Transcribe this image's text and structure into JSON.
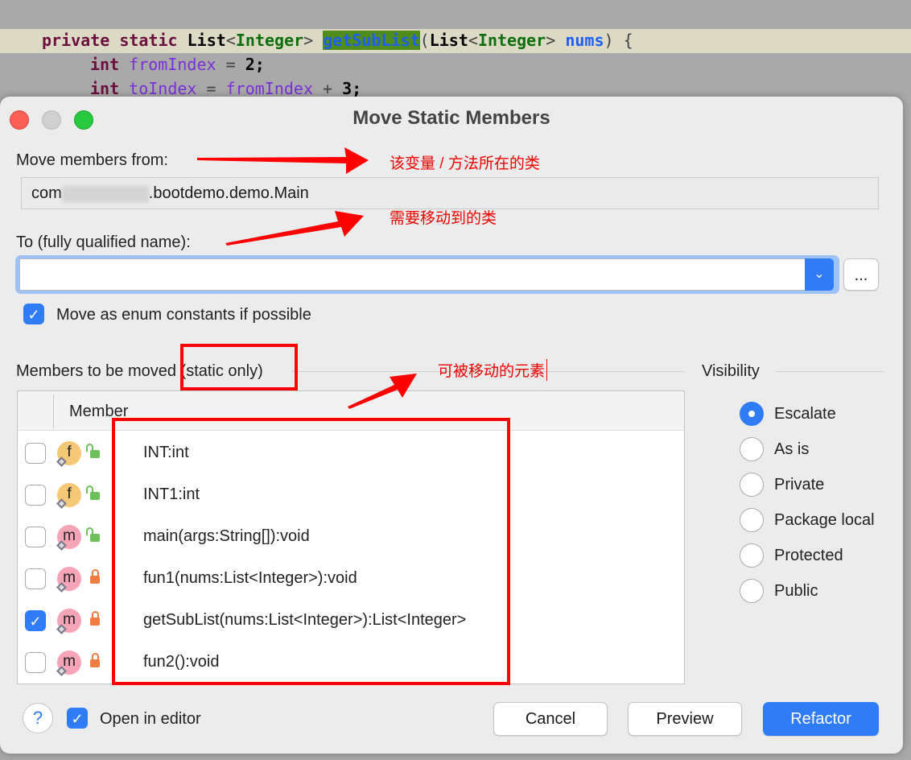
{
  "editor": {
    "line1": {
      "kw1": "private",
      "kw2": "static",
      "type": "List",
      "lt": "<",
      "gen": "Integer",
      "gt": ">",
      "name": "getSubList",
      "open": "(",
      "ptype": "List",
      "pgen": "Integer",
      "param": "nums",
      "close": ") {"
    },
    "line2": {
      "kw": "int",
      "var": "fromIndex",
      "op": "=",
      "val": "2;"
    },
    "line3": {
      "kw": "int",
      "var": "toIndex",
      "op": "=",
      "var2": "fromIndex",
      "plus": "+",
      "val": "3;"
    }
  },
  "dialog": {
    "title": "Move Static Members",
    "from_label": "Move members from:",
    "from_prefix": "com",
    "from_suffix": ".bootdemo.demo.Main",
    "to_label": "To (fully qualified name):",
    "to_value": "",
    "browse_label": "...",
    "enum_label": "Move as enum constants if possible",
    "enum_checked": true,
    "members_label": "Members to be moved (static only)",
    "member_header": "Member",
    "members": [
      {
        "name": "INT:int",
        "kind": "f",
        "access": "public",
        "checked": false
      },
      {
        "name": "INT1:int",
        "kind": "f",
        "access": "public",
        "checked": false
      },
      {
        "name": "main(args:String[]):void",
        "kind": "m",
        "access": "public",
        "checked": false
      },
      {
        "name": "fun1(nums:List<Integer>):void",
        "kind": "m",
        "access": "private",
        "checked": false
      },
      {
        "name": "getSubList(nums:List<Integer>):List<Integer>",
        "kind": "m",
        "access": "private",
        "checked": true
      },
      {
        "name": "fun2():void",
        "kind": "m",
        "access": "private",
        "checked": false
      }
    ],
    "visibility_label": "Visibility",
    "visibility": [
      {
        "label": "Escalate",
        "selected": true
      },
      {
        "label": "As is"
      },
      {
        "label": "Private"
      },
      {
        "label": "Package local"
      },
      {
        "label": "Protected"
      },
      {
        "label": "Public"
      }
    ],
    "help": "?",
    "open_editor_label": "Open in editor",
    "open_editor_checked": true,
    "cancel": "Cancel",
    "preview": "Preview",
    "refactor": "Refactor"
  },
  "annotations": {
    "a1": "该变量 / 方法所在的类",
    "a2": "需要移动到的类",
    "a3": "可被移动的元素"
  },
  "colors": {
    "accent": "#2f7cf6",
    "annotation": "#ff0000"
  }
}
